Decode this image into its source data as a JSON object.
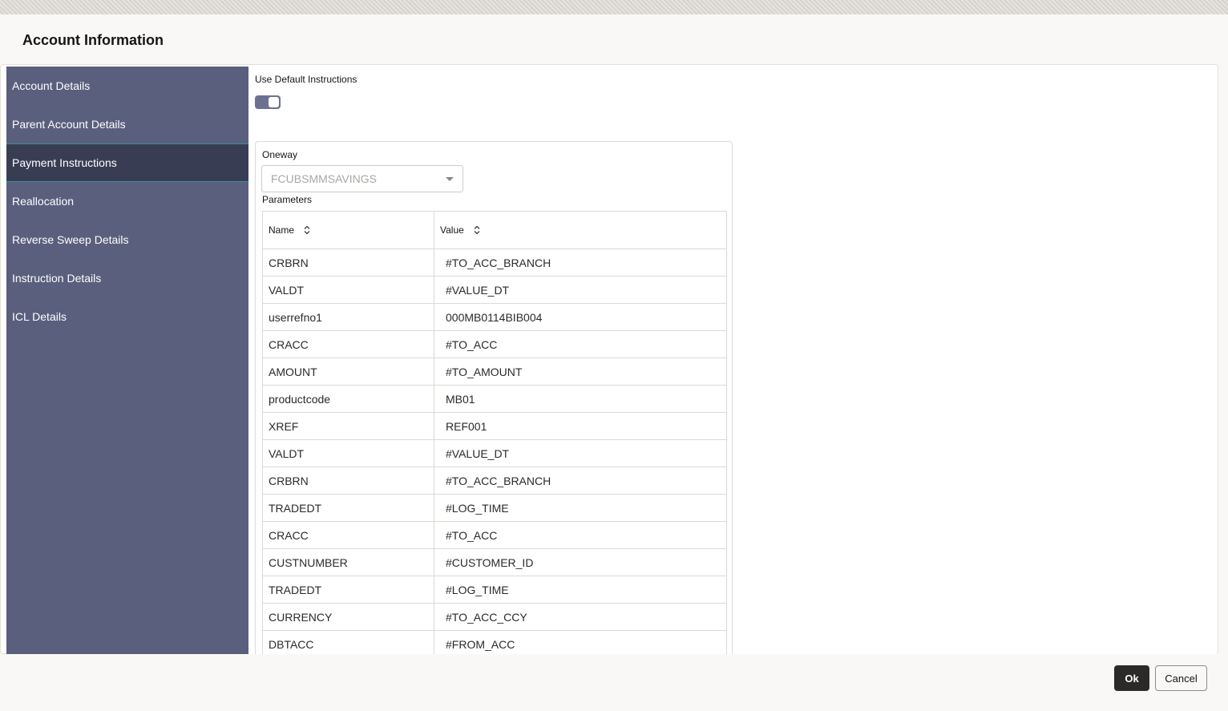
{
  "dialog": {
    "title": "Account Information"
  },
  "sidebar": {
    "items": [
      {
        "label": "Account Details"
      },
      {
        "label": "Parent Account Details"
      },
      {
        "label": "Payment Instructions",
        "active": true
      },
      {
        "label": "Reallocation"
      },
      {
        "label": "Reverse Sweep Details"
      },
      {
        "label": "Instruction Details"
      },
      {
        "label": "ICL Details"
      }
    ]
  },
  "main": {
    "toggle_label": "Use Default Instructions",
    "toggle_on": true,
    "oneway_label": "Oneway",
    "oneway_value": "FCUBSMMSAVINGS",
    "parameters_label": "Parameters",
    "table": {
      "columns": [
        "Name",
        "Value"
      ],
      "rows": [
        [
          "CRBRN",
          "#TO_ACC_BRANCH"
        ],
        [
          "VALDT",
          "#VALUE_DT"
        ],
        [
          "userrefno1",
          "000MB0114BIB004"
        ],
        [
          "CRACC",
          "#TO_ACC"
        ],
        [
          "AMOUNT",
          "#TO_AMOUNT"
        ],
        [
          "productcode",
          "MB01"
        ],
        [
          "XREF",
          "REF001"
        ],
        [
          "VALDT",
          "#VALUE_DT"
        ],
        [
          "CRBRN",
          "#TO_ACC_BRANCH"
        ],
        [
          "TRADEDT",
          "#LOG_TIME"
        ],
        [
          "CRACC",
          "#TO_ACC"
        ],
        [
          "CUSTNUMBER",
          "#CUSTOMER_ID"
        ],
        [
          "TRADEDT",
          "#LOG_TIME"
        ],
        [
          "CURRENCY",
          "#TO_ACC_CCY"
        ],
        [
          "DBTACC",
          "#FROM_ACC"
        ]
      ]
    }
  },
  "footer": {
    "ok_label": "Ok",
    "cancel_label": "Cancel"
  },
  "colors": {
    "sidebar_bg": "#5a5f7d",
    "sidebar_active_bg": "#393d54",
    "toggle_bg": "#6c7190",
    "primary_button": "#2b2a28"
  }
}
